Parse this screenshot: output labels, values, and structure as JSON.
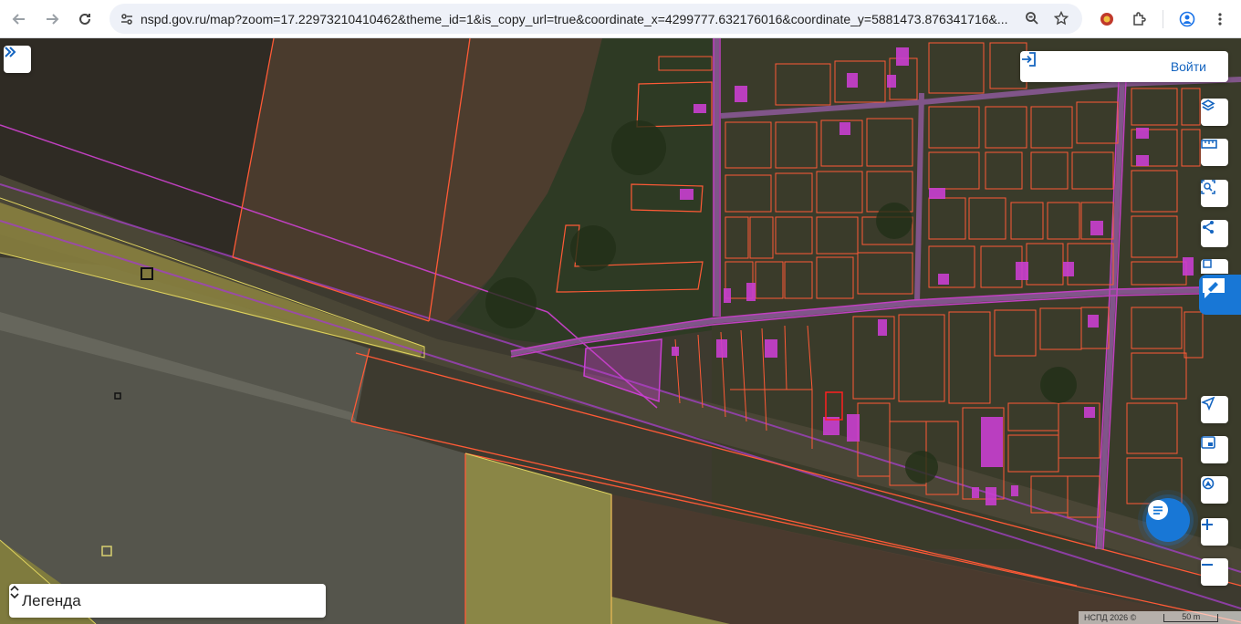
{
  "browser": {
    "url": "nspd.gov.ru/map?zoom=17.22973210410462&theme_id=1&is_copy_url=true&coordinate_x=4299777.632176016&coordinate_y=5881473.876341716&..."
  },
  "map": {
    "login_label": "Войти",
    "legend_label": "Легенда",
    "attribution": "НСПД 2026 ©",
    "scale_label": "50 m",
    "colors": {
      "parcel_outline": "#ff5a36",
      "building_fill": "#c93fd0",
      "road_outline": "#a040c0",
      "farmland_fill": "#b7ad3a",
      "accent": "#1877d6"
    },
    "right_toolbar_icons": [
      "layers-icon",
      "ruler-icon",
      "select-area-icon",
      "share-icon",
      "print-icon"
    ],
    "lower_toolbar_icons": [
      "locate-icon",
      "picture-in-picture-icon",
      "geolocation-icon",
      "zoom-in-icon",
      "zoom-out-icon"
    ]
  }
}
